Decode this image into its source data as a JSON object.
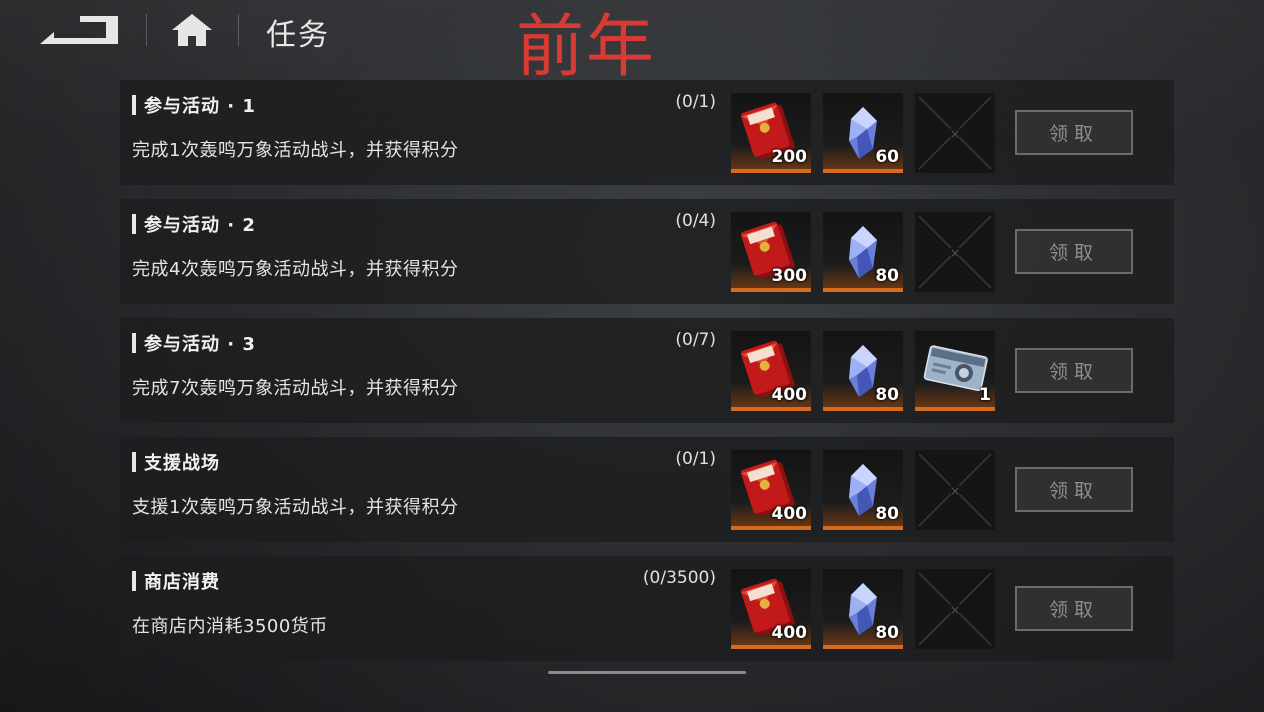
{
  "header": {
    "title": "任务",
    "overlay_text": "前年"
  },
  "tasks": [
    {
      "title": "参与活动 · 1",
      "progress": "(0/1)",
      "description": "完成1次轰鸣万象活动战斗，并获得积分",
      "rewards": [
        {
          "icon": "red-envelope-icon",
          "qty": "200"
        },
        {
          "icon": "crystal-icon",
          "qty": "60"
        },
        {
          "icon": "empty-slot",
          "qty": ""
        }
      ],
      "button": "领取"
    },
    {
      "title": "参与活动 · 2",
      "progress": "(0/4)",
      "description": "完成4次轰鸣万象活动战斗，并获得积分",
      "rewards": [
        {
          "icon": "red-envelope-icon",
          "qty": "300"
        },
        {
          "icon": "crystal-icon",
          "qty": "80"
        },
        {
          "icon": "empty-slot",
          "qty": ""
        }
      ],
      "button": "领取"
    },
    {
      "title": "参与活动 · 3",
      "progress": "(0/7)",
      "description": "完成7次轰鸣万象活动战斗，并获得积分",
      "rewards": [
        {
          "icon": "red-envelope-icon",
          "qty": "400"
        },
        {
          "icon": "crystal-icon",
          "qty": "80"
        },
        {
          "icon": "ticket-card-icon",
          "qty": "1"
        }
      ],
      "button": "领取"
    },
    {
      "title": "支援战场",
      "progress": "(0/1)",
      "description": "支援1次轰鸣万象活动战斗，并获得积分",
      "rewards": [
        {
          "icon": "red-envelope-icon",
          "qty": "400"
        },
        {
          "icon": "crystal-icon",
          "qty": "80"
        },
        {
          "icon": "empty-slot",
          "qty": ""
        }
      ],
      "button": "领取"
    },
    {
      "title": "商店消费",
      "progress": "(0/3500)",
      "description": "在商店内消耗3500货币",
      "rewards": [
        {
          "icon": "red-envelope-icon",
          "qty": "400"
        },
        {
          "icon": "crystal-icon",
          "qty": "80"
        },
        {
          "icon": "empty-slot",
          "qty": ""
        }
      ],
      "button": "领取"
    }
  ],
  "colors": {
    "accent_orange": "#d76a1c",
    "overlay_red": "#d93a34",
    "envelope_red": "#c21a1a"
  }
}
